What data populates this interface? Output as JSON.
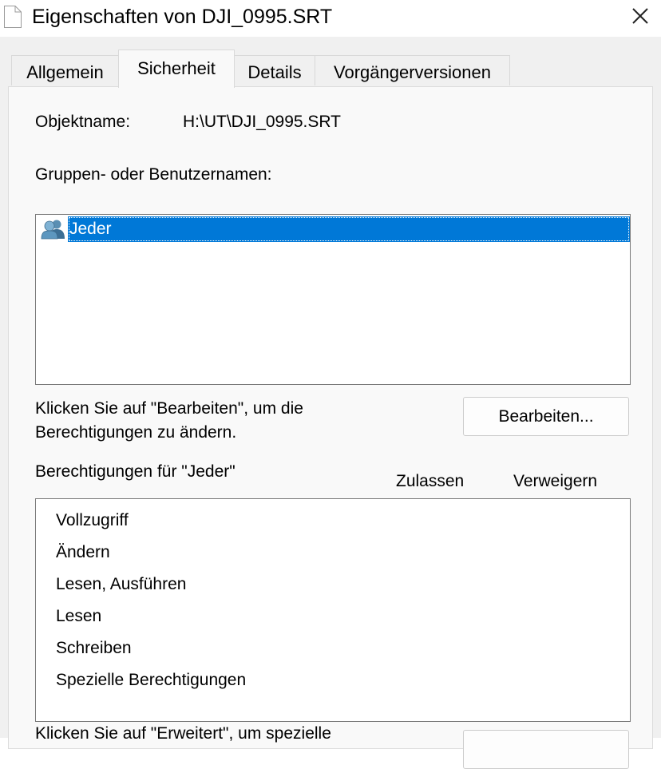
{
  "window": {
    "title": "Eigenschaften von DJI_0995.SRT",
    "file_icon": "document-icon",
    "close_icon": "close-icon"
  },
  "tabs": [
    {
      "label": "Allgemein",
      "active": false
    },
    {
      "label": "Sicherheit",
      "active": true
    },
    {
      "label": "Details",
      "active": false
    },
    {
      "label": "Vorgängerversionen",
      "active": false
    }
  ],
  "security": {
    "object_label": "Objektname:",
    "object_value": "H:\\UT\\DJI_0995.SRT",
    "groups_label": "Gruppen- oder Benutzernamen:",
    "groups": [
      {
        "name": "Jeder",
        "icon": "users-icon",
        "selected": true
      }
    ],
    "edit_hint_line1": "Klicken Sie auf \"Bearbeiten\", um die",
    "edit_hint_line2": "Berechtigungen zu ändern.",
    "edit_button": "Bearbeiten...",
    "permissions_label": "Berechtigungen für \"Jeder\"",
    "col_allow": "Zulassen",
    "col_deny": "Verweigern",
    "permissions": [
      {
        "name": "Vollzugriff"
      },
      {
        "name": "Ändern"
      },
      {
        "name": "Lesen, Ausführen"
      },
      {
        "name": "Lesen"
      },
      {
        "name": "Schreiben"
      },
      {
        "name": "Spezielle Berechtigungen"
      }
    ],
    "advanced_hint_line1": "Klicken Sie auf \"Erweitert\", um spezielle"
  },
  "colors": {
    "selection": "#0078d7",
    "dialog_bg": "#f0f0f0",
    "panel_bg": "#f9f9f9"
  }
}
